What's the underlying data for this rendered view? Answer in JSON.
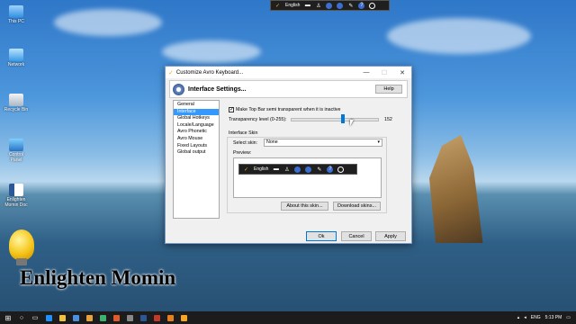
{
  "desktop": {
    "icons": [
      {
        "name": "this-pc",
        "label": "This PC"
      },
      {
        "name": "network",
        "label": "Network"
      },
      {
        "name": "recycle-bin",
        "label": "Recycle Bin"
      },
      {
        "name": "control-panel",
        "label": "Control Panel"
      },
      {
        "name": "word-doc",
        "label": "Enlighten Momin Doc"
      }
    ],
    "brand_text": "Enlighten Momin"
  },
  "topbar": {
    "language": "English"
  },
  "dialog": {
    "title": "Customize Avro Keyboard...",
    "header_title": "Interface Settings...",
    "help_label": "Help",
    "nav_items": [
      "General",
      "Interface",
      "Global Hotkeys",
      "Locale/Language",
      "Avro Phonetic",
      "Avro Mouse",
      "Fixed Layouts",
      "Global output"
    ],
    "selected_nav": "Interface",
    "checkbox_label": "Make Top Bar semi transparent when it is inactive",
    "checkbox_checked": true,
    "transparency_label": "Transparency level (0-255):",
    "transparency_value": "152",
    "transparency_fraction": 0.596,
    "skin_group_label": "Interface Skin",
    "select_skin_label": "Select skin:",
    "select_skin_value": "None",
    "preview_label": "Preview:",
    "about_skin_label": "About this skin...",
    "download_skins_label": "Download skins...",
    "ok_label": "Ok",
    "cancel_label": "Cancel",
    "apply_label": "Apply"
  },
  "taskbar": {
    "language": "ENG",
    "time": "5:13 PM"
  },
  "colors": {
    "accent": "#0078d7",
    "selection": "#3399ff",
    "taskbar": "#1c1c1c"
  }
}
